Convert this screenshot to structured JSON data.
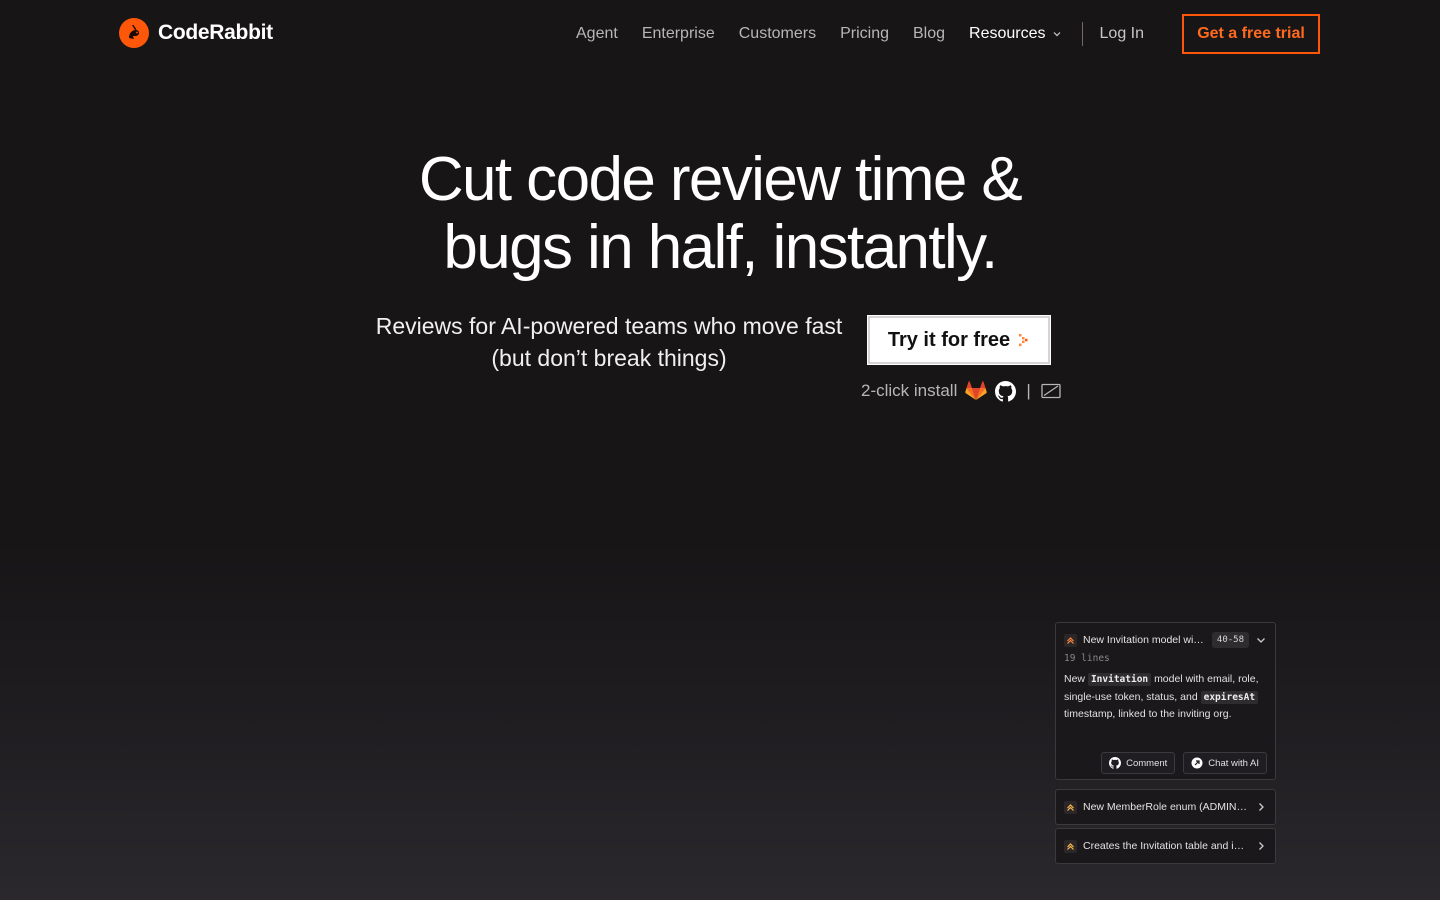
{
  "brand": {
    "name": "CodeRabbit",
    "accent": "#ff570a"
  },
  "nav": {
    "links": [
      "Agent",
      "Enterprise",
      "Customers",
      "Pricing",
      "Blog"
    ],
    "resources_label": "Resources",
    "login_label": "Log In",
    "trial_label": "Get a free trial"
  },
  "hero": {
    "title_line1": "Cut code review time &",
    "title_line2": "bugs in half, instantly.",
    "subtitle": "Reviews for AI-powered teams who move fast (but don’t break things)",
    "cta_label": "Try it for free",
    "install_label": "2-click install",
    "install_separator": "|",
    "install_icons": [
      "gitlab-icon",
      "github-icon",
      "azure-devops-icon"
    ]
  },
  "review_panel": {
    "main": {
      "title": "New Invitation model with email, role, token",
      "range": "40-58",
      "lines": "19 lines",
      "desc_prefix": "New",
      "desc_code1": "Invitation",
      "desc_mid": "model with email, role, single-use token, status, and",
      "desc_code2": "expiresAt",
      "desc_suffix": "timestamp, linked to the inviting org.",
      "comment_label": "Comment",
      "chat_label": "Chat with AI"
    },
    "items": [
      {
        "title": "New MemberRole enum (ADMIN, MEMBER)"
      },
      {
        "title": "Creates the Invitation table and indexes"
      }
    ]
  }
}
